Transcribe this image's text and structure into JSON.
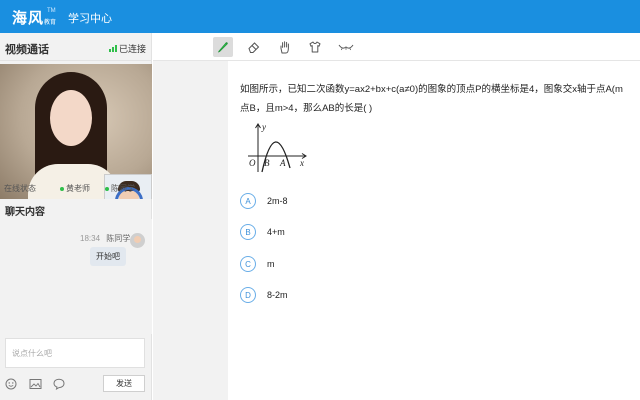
{
  "header": {
    "logo_main": "海风",
    "logo_sub": "教育",
    "logo_sup": "TM",
    "title": "学习中心"
  },
  "video_panel": {
    "title": "视频通话",
    "connection_status": "已连接",
    "status_label": "在线状态",
    "teacher_name": "黄老师",
    "student_name": "陈同学",
    "status_color": "#2fbf4a"
  },
  "chat": {
    "title": "聊天内容",
    "messages": [
      {
        "time": "18:34",
        "sender": "陈同学",
        "text": "开始吧"
      }
    ],
    "input_placeholder": "说点什么吧",
    "send_label": "发送",
    "tool_icons": [
      "emoji-icon",
      "image-icon",
      "chat-bubble-icon"
    ]
  },
  "toolbar": {
    "tools": [
      "pen-icon",
      "eraser-icon",
      "hand-icon",
      "shirt-icon",
      "wave-icon"
    ],
    "active_tool": "pen-icon"
  },
  "question": {
    "line1": "如图所示，已知二次函数y=ax2+bx+c(a≠0)的图象的顶点P的横坐标是4，图象交x轴于点A(m",
    "line2": "点B，且m>4，那么AB的长是(  )",
    "graph_labels": {
      "y": "y",
      "x": "x",
      "o": "O",
      "b": "B",
      "a": "A"
    },
    "options": [
      {
        "letter": "A",
        "text": "2m-8"
      },
      {
        "letter": "B",
        "text": "4+m"
      },
      {
        "letter": "C",
        "text": "m"
      },
      {
        "letter": "D",
        "text": "8-2m"
      }
    ]
  },
  "colors": {
    "brand": "#1a8fe0",
    "pen_active": "#2fbf4a",
    "option_accent": "#3b8fd9"
  }
}
